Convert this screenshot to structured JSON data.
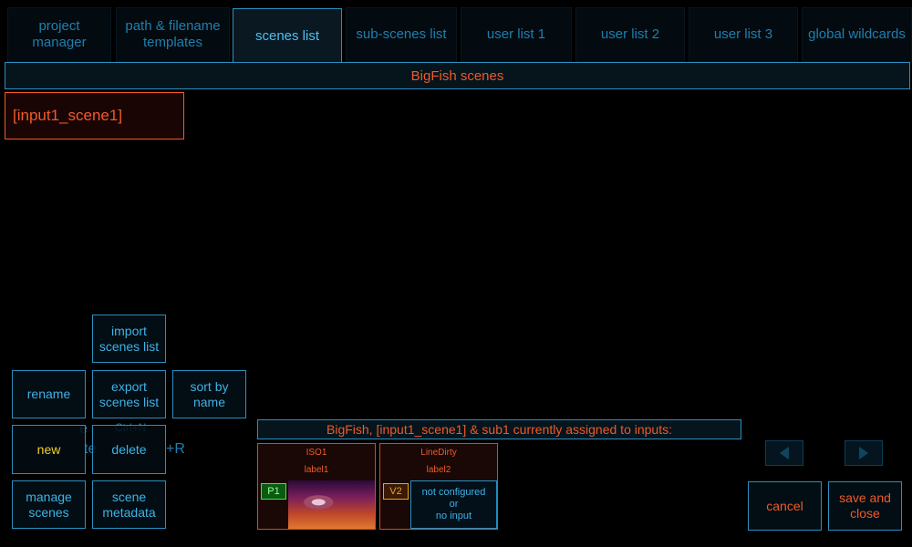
{
  "tabs": [
    {
      "label": "project\nmanager",
      "active": false
    },
    {
      "label": "path & filename\ntemplates",
      "active": false
    },
    {
      "label": "scenes list",
      "active": true
    },
    {
      "label": "sub-scenes list",
      "active": false
    },
    {
      "label": "user list 1",
      "active": false
    },
    {
      "label": "user list 2",
      "active": false
    },
    {
      "label": "user list 3",
      "active": false
    },
    {
      "label": "global wildcards",
      "active": false
    }
  ],
  "scenes_header": "BigFish scenes",
  "scenes": [
    "[input1_scene1]"
  ],
  "buttons": {
    "import": "import\nscenes list",
    "rename": "rename",
    "export": "export\nscenes list",
    "sort": "sort by\nname",
    "new": "new",
    "delete": "delete",
    "manage": "manage\nscenes",
    "metadata": "scene\nmetadata",
    "cancel": "cancel",
    "save_close": "save and\nclose"
  },
  "assign_header": "BigFish, [input1_scene1] & sub1 currently assigned to inputs:",
  "inputs": [
    {
      "name": "ISO1",
      "label": "label1",
      "badge": "P1"
    },
    {
      "name": "LineDirty",
      "label": "label2",
      "badge": "V2",
      "status": "not configured\nor\nno input"
    }
  ],
  "colors": {
    "accent": "#2a8fc0",
    "alert": "#f05a28",
    "live": "#4ee04e",
    "warn": "#f0a020"
  }
}
